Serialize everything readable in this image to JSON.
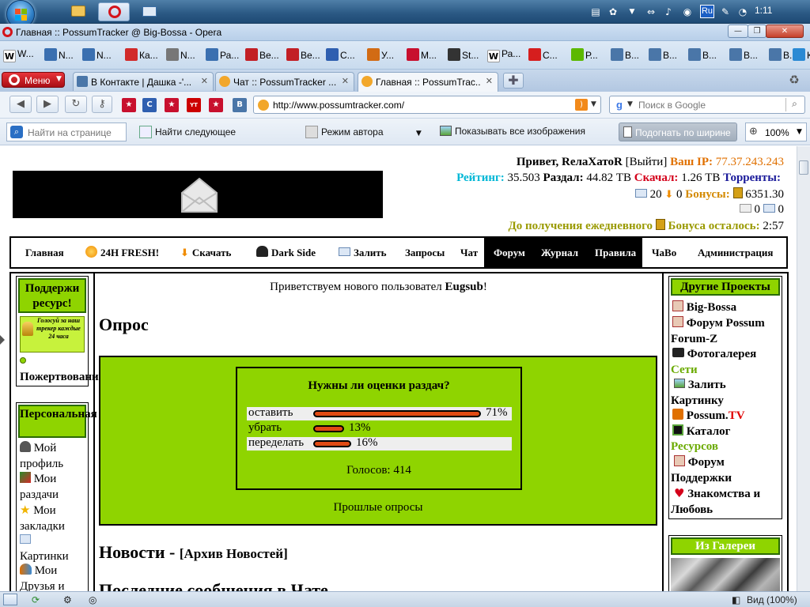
{
  "taskbar": {
    "clock": "1:11",
    "tray_lang": "Ru"
  },
  "window": {
    "title": "Главная :: PossumTracker @ Big-Bossa - Opera"
  },
  "bookmarks": [
    {
      "label": "W...",
      "icon": "wikipedia-icon",
      "color": "#ffffff"
    },
    {
      "label": "N...",
      "icon": "page-icon",
      "color": "#3a6fb0"
    },
    {
      "label": "N...",
      "icon": "page-icon",
      "color": "#3a6fb0"
    },
    {
      "label": "Ка...",
      "icon": "k-icon",
      "color": "#d12a2a"
    },
    {
      "label": "N...",
      "icon": "tool-icon",
      "color": "#777777"
    },
    {
      "label": "Ра...",
      "icon": "page-icon",
      "color": "#3a6fb0"
    },
    {
      "label": "Be...",
      "icon": "bird-icon",
      "color": "#c21f25"
    },
    {
      "label": "Be...",
      "icon": "bird-icon",
      "color": "#c21f25"
    },
    {
      "label": "С...",
      "icon": "c-icon",
      "color": "#2f5fb0"
    },
    {
      "label": "У...",
      "icon": "ru-icon",
      "color": "#d26b14"
    },
    {
      "label": "М...",
      "icon": "star-icon",
      "color": "#c8102e"
    },
    {
      "label": "St...",
      "icon": "stop-icon",
      "color": "#333333"
    },
    {
      "label": "Ра...",
      "icon": "wikipedia-icon",
      "color": "#ffffff"
    },
    {
      "label": "С...",
      "icon": "spider-icon",
      "color": "#d61e1e"
    },
    {
      "label": "Р...",
      "icon": "play-icon",
      "color": "#5cb800"
    },
    {
      "label": "В...",
      "icon": "vk-icon",
      "color": "#4a76a8"
    },
    {
      "label": "В...",
      "icon": "vk-icon",
      "color": "#4a76a8"
    },
    {
      "label": "В...",
      "icon": "vk-icon",
      "color": "#4a76a8"
    },
    {
      "label": "В...",
      "icon": "vk-icon",
      "color": "#4a76a8"
    },
    {
      "label": "В...",
      "icon": "vk-icon",
      "color": "#4a76a8"
    },
    {
      "label": "К...",
      "icon": "cart-icon",
      "color": "#2a8ad4"
    }
  ],
  "tabs": {
    "menu_label": "Меню",
    "items": [
      {
        "label": "В Контакте | Дашка -'...",
        "active": false
      },
      {
        "label": "Чат :: PossumTracker ...",
        "active": false
      },
      {
        "label": "Главная :: PossumTrac...",
        "active": true
      }
    ]
  },
  "nav": {
    "url": "http://www.possumtracker.com/",
    "search_placeholder": "Поиск в Google"
  },
  "findbar": {
    "find_placeholder": "Найти на странице",
    "find_next": "Найти следующее",
    "author_mode": "Режим автора",
    "show_images": "Показывать все изображения",
    "fit_width": "Подогнать по ширине",
    "zoom": "100%"
  },
  "userinfo": {
    "greeting": "Привет, ",
    "username": "RелaXатоR",
    "logout": "[Выйти]",
    "ip_label": "Ваш IP:",
    "ip_value": "77.37.243.243",
    "rating_label": "Рейтинг:",
    "rating_value": "35.503",
    "uploaded_label": "Раздал:",
    "uploaded_value": "44.82 TB",
    "downloaded_label": "Скачал:",
    "downloaded_value": "1.26 TB",
    "torrents_label": "Торренты:",
    "seeding": "20",
    "leeching": "0",
    "bonus_label": "Бонусы:",
    "bonus_value": "6351.30",
    "inbox": "0",
    "outbox": "0",
    "daily_prefix": "До получения ежедневного",
    "daily_bonus": "Бонуса осталось:",
    "daily_time": "2:57"
  },
  "menu": [
    "Главная",
    "24H FRESH!",
    "Скачать",
    "Dark Side",
    "Залить",
    "Запросы",
    "Чат",
    "Форум",
    "Журнал",
    "Правила",
    "ЧаВо",
    "Администрация"
  ],
  "left": {
    "support_title": "Поддержи ресурс!",
    "vote_badge": "Голосуй за наш трекер каждые 24 часа",
    "donate": "Пожертвования",
    "personal_title": "Персональная",
    "links": [
      "Мой профиль",
      "Мои раздачи",
      "Мои закладки",
      "Картинки",
      "Мои Друзья и"
    ]
  },
  "center": {
    "welcome_prefix": "Приветствуем нового пользовател",
    "welcome_user": "Eugsub",
    "welcome_suffix": "!",
    "poll_heading": "Опрос",
    "poll_question": "Нужны ли оценки раздач?",
    "poll_votes": "Голосов: 414",
    "poll_past": "Прошлые опросы",
    "news_title": "Новости -",
    "news_archive": "[Архив Новостей]",
    "chat_title": "Последние сообщения в Чате"
  },
  "chart_data": {
    "type": "bar",
    "categories": [
      "оставить",
      "убрать",
      "переделать"
    ],
    "values": [
      71,
      13,
      16
    ],
    "value_labels": [
      "71%",
      "13%",
      "16%"
    ],
    "xlim": [
      0,
      100
    ],
    "colors": {
      "bar": "#e04a14"
    }
  },
  "right": {
    "projects_title": "Другие Проекты",
    "items": [
      {
        "label": "Big-Bossa"
      },
      {
        "label": "Форум Possum Forum-Z"
      },
      {
        "label": "Фотогалерея"
      }
    ],
    "networks_section": "Сети",
    "upload_pics": "Залить Картинку",
    "possum_tv_a": "Possum.",
    "possum_tv_b": "TV",
    "catalog": "Каталог",
    "resources_section": "Ресурсов",
    "support_forum": "Форум Поддержки",
    "dating": "Знакомства и Любовь",
    "gallery_title": "Из Галереи"
  },
  "status": {
    "zoom_text": "Вид (100%)"
  },
  "colors": {
    "accent_green": "#8fd400",
    "ip_orange": "#e07000",
    "rating_cyan": "#00b7d6",
    "downloaded_red": "#d4001a",
    "torrents_navy": "#1a1a9a",
    "bonus_orange": "#d48a00",
    "daily_olive": "#9a9a00"
  }
}
